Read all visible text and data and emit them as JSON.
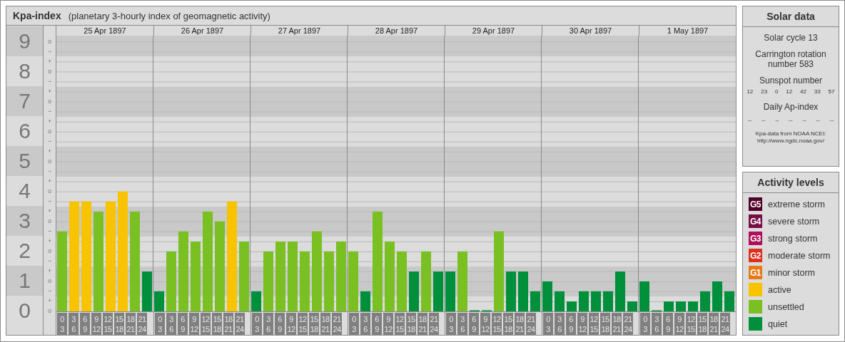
{
  "kp_panel": {
    "title": "Kpa-index",
    "subtitle": "(planetary 3-hourly index of geomagnetic activity)",
    "scale_marks": [
      "o",
      "−",
      "+",
      "o",
      "−",
      "+",
      "o",
      "−",
      "+",
      "o",
      "−",
      "+",
      "o",
      "−",
      "+",
      "o",
      "−",
      "+",
      "o",
      "−",
      "+",
      "o",
      "−",
      "+",
      "o",
      "−",
      "+",
      "o"
    ],
    "days": [
      {
        "date": "25 Apr 1897",
        "slots": [
          {
            "from": "0",
            "to": "3"
          },
          {
            "from": "3",
            "to": "6"
          },
          {
            "from": "6",
            "to": "9"
          },
          {
            "from": "9",
            "to": "12"
          },
          {
            "from": "12",
            "to": "15"
          },
          {
            "from": "15",
            "to": "18"
          },
          {
            "from": "18",
            "to": "21"
          },
          {
            "from": "21",
            "to": "24"
          }
        ]
      },
      {
        "date": "26 Apr 1897",
        "slots": [
          {
            "from": "0",
            "to": "3"
          },
          {
            "from": "3",
            "to": "6"
          },
          {
            "from": "6",
            "to": "9"
          },
          {
            "from": "9",
            "to": "12"
          },
          {
            "from": "12",
            "to": "15"
          },
          {
            "from": "15",
            "to": "18"
          },
          {
            "from": "18",
            "to": "21"
          },
          {
            "from": "21",
            "to": "24"
          }
        ]
      },
      {
        "date": "27 Apr 1897",
        "slots": [
          {
            "from": "0",
            "to": "3"
          },
          {
            "from": "3",
            "to": "6"
          },
          {
            "from": "6",
            "to": "9"
          },
          {
            "from": "9",
            "to": "12"
          },
          {
            "from": "12",
            "to": "15"
          },
          {
            "from": "15",
            "to": "18"
          },
          {
            "from": "18",
            "to": "21"
          },
          {
            "from": "21",
            "to": "24"
          }
        ]
      },
      {
        "date": "28 Apr 1897",
        "slots": [
          {
            "from": "0",
            "to": "3"
          },
          {
            "from": "3",
            "to": "6"
          },
          {
            "from": "6",
            "to": "9"
          },
          {
            "from": "9",
            "to": "12"
          },
          {
            "from": "12",
            "to": "15"
          },
          {
            "from": "15",
            "to": "18"
          },
          {
            "from": "18",
            "to": "21"
          },
          {
            "from": "21",
            "to": "24"
          }
        ]
      },
      {
        "date": "29 Apr 1897",
        "slots": [
          {
            "from": "0",
            "to": "3"
          },
          {
            "from": "3",
            "to": "6"
          },
          {
            "from": "6",
            "to": "9"
          },
          {
            "from": "9",
            "to": "12"
          },
          {
            "from": "12",
            "to": "15"
          },
          {
            "from": "15",
            "to": "18"
          },
          {
            "from": "18",
            "to": "21"
          },
          {
            "from": "21",
            "to": "24"
          }
        ]
      },
      {
        "date": "30 Apr 1897",
        "slots": [
          {
            "from": "0",
            "to": "3"
          },
          {
            "from": "3",
            "to": "6"
          },
          {
            "from": "6",
            "to": "9"
          },
          {
            "from": "9",
            "to": "12"
          },
          {
            "from": "12",
            "to": "15"
          },
          {
            "from": "15",
            "to": "18"
          },
          {
            "from": "18",
            "to": "21"
          },
          {
            "from": "21",
            "to": "24"
          }
        ]
      },
      {
        "date": "1 May 1897",
        "slots": [
          {
            "from": "0",
            "to": "3"
          },
          {
            "from": "3",
            "to": "6"
          },
          {
            "from": "6",
            "to": "9"
          },
          {
            "from": "9",
            "to": "12"
          },
          {
            "from": "12",
            "to": "15"
          },
          {
            "from": "15",
            "to": "18"
          },
          {
            "from": "18",
            "to": "21"
          },
          {
            "from": "21",
            "to": "24"
          }
        ]
      }
    ],
    "chart_data": {
      "type": "bar",
      "ylim": [
        0,
        9.2
      ],
      "grid": true,
      "yticks": [
        {
          "value": 9,
          "label": "9"
        },
        {
          "value": 8,
          "label": "8"
        },
        {
          "value": 7,
          "label": "7"
        },
        {
          "value": 6,
          "label": "6"
        },
        {
          "value": 5,
          "label": "5"
        },
        {
          "value": 4,
          "label": "4"
        },
        {
          "value": 3,
          "label": "3"
        },
        {
          "value": 2,
          "label": "2"
        },
        {
          "value": 1,
          "label": "1"
        },
        {
          "value": 0,
          "label": "0"
        }
      ],
      "series": [
        {
          "name": "quiet",
          "color": "#008f3b",
          "values": [
            null,
            null,
            null,
            null,
            null,
            null,
            null,
            1.33,
            0.67,
            null,
            null,
            null,
            null,
            null,
            null,
            null,
            0.67,
            null,
            null,
            null,
            null,
            null,
            null,
            null,
            null,
            0.67,
            null,
            null,
            null,
            1.33,
            null,
            1.33,
            1.33,
            null,
            0,
            0,
            null,
            1.33,
            1.33,
            0.67,
            1,
            0.67,
            0.33,
            0.67,
            0.67,
            0.67,
            1.33,
            0.33,
            1,
            0,
            0.33,
            0.33,
            0.33,
            0.67,
            1,
            0.67
          ]
        },
        {
          "name": "unsettled",
          "color": "#7ac023",
          "values": [
            2.67,
            null,
            null,
            3.33,
            null,
            null,
            3.33,
            null,
            null,
            2,
            2.67,
            2.33,
            3.33,
            3,
            null,
            2.33,
            null,
            2,
            2.33,
            2.33,
            2,
            2.67,
            2,
            2.33,
            2,
            null,
            3.33,
            2.33,
            2,
            null,
            2,
            null,
            null,
            2,
            null,
            null,
            2.67,
            null,
            null,
            null,
            null,
            null,
            null,
            null,
            null,
            null,
            null,
            null,
            null,
            null,
            null,
            null,
            null,
            null,
            null,
            null
          ]
        },
        {
          "name": "active",
          "color": "#f8c400",
          "values": [
            null,
            3.67,
            3.67,
            null,
            3.67,
            4,
            null,
            null,
            null,
            null,
            null,
            null,
            null,
            null,
            3.67,
            null,
            null,
            null,
            null,
            null,
            null,
            null,
            null,
            null,
            null,
            null,
            null,
            null,
            null,
            null,
            null,
            null,
            null,
            null,
            null,
            null,
            null,
            null,
            null,
            null,
            null,
            null,
            null,
            null,
            null,
            null,
            null,
            null,
            null,
            null,
            null,
            null,
            null,
            null,
            null,
            null
          ]
        }
      ]
    }
  },
  "solar_data": {
    "title": "Solar data",
    "solar_cycle": "Solar cycle 13",
    "carrington": "Carrington rotation number 583",
    "sunspot_title": "Sunspot number",
    "sunspot_numbers": [
      "12",
      "23",
      "0",
      "12",
      "42",
      "33",
      "57"
    ],
    "ap_title": "Daily Ap-index",
    "ap_values": [
      "--",
      "--",
      "--",
      "--",
      "--",
      "--",
      "--"
    ],
    "source": "Kpa-data from NOAA NCEI:",
    "source_url": "http://www.ngdc.noaa.gov/"
  },
  "activity_levels": {
    "title": "Activity levels",
    "items": [
      {
        "badge": "G5",
        "label": "extreme storm",
        "color": "#520027"
      },
      {
        "badge": "G4",
        "label": "severe storm",
        "color": "#780d45"
      },
      {
        "badge": "G3",
        "label": "strong storm",
        "color": "#ae0f5c"
      },
      {
        "badge": "G2",
        "label": "moderate storm",
        "color": "#dd3020"
      },
      {
        "badge": "G1",
        "label": "minor storm",
        "color": "#e67a1a"
      }
    ]
  }
}
